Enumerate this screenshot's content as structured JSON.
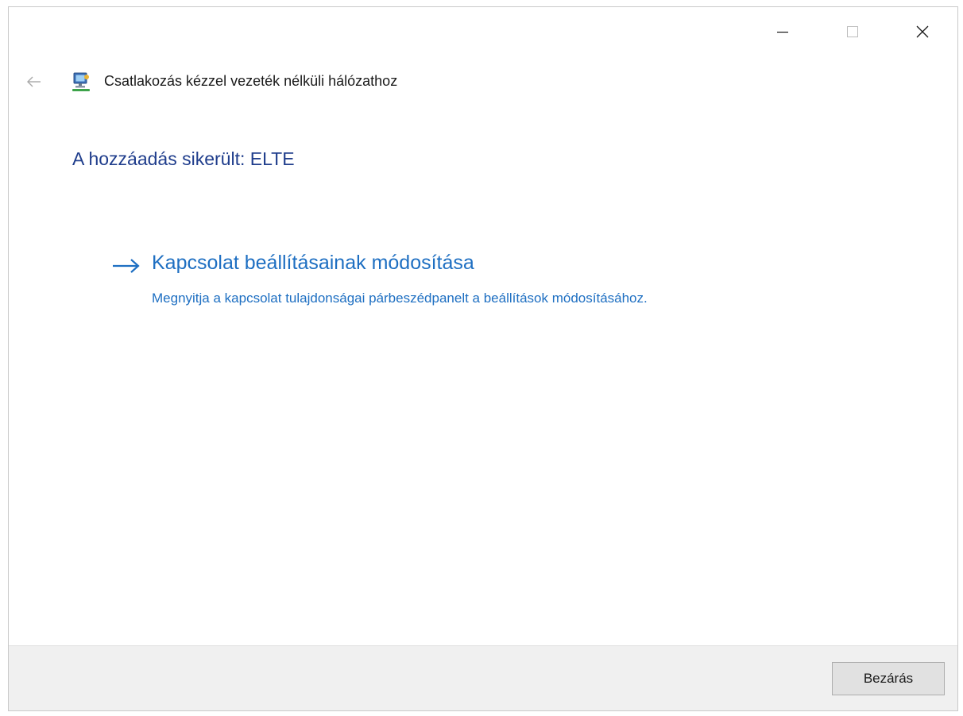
{
  "window": {
    "controls": {
      "minimize": "minimize-icon",
      "maximize": "maximize-icon",
      "close": "close-icon"
    }
  },
  "nav": {
    "back_icon": "back-arrow-icon",
    "app_icon": "network-icon",
    "title": "Csatlakozás kézzel vezeték nélküli hálózathoz"
  },
  "main": {
    "heading": "A hozzáadás sikerült: ELTE",
    "task": {
      "icon": "arrow-right-icon",
      "title": "Kapcsolat beállításainak módosítása",
      "description": "Megnyitja a kapcsolat tulajdonságai párbeszédpanelt a beállítások módosításához."
    }
  },
  "footer": {
    "close_label": "Bezárás"
  },
  "colors": {
    "heading": "#1f3d8c",
    "link": "#1e6fc2",
    "footer_bg": "#f0f0f0"
  }
}
